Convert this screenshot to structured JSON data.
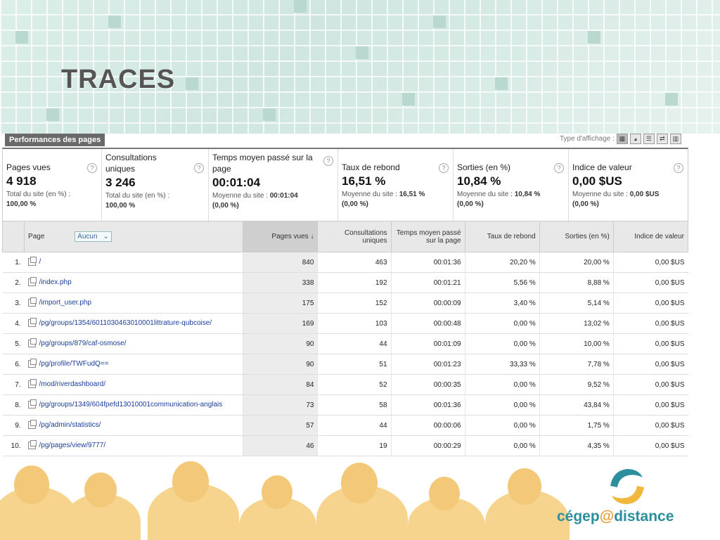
{
  "slide": {
    "title": "TRACES",
    "logo_text_1": "cégep",
    "logo_at": "@",
    "logo_text_2": "distance"
  },
  "panel": {
    "tab_label": "Performances des pages",
    "view_type_label": "Type d'affichage :"
  },
  "metrics": [
    {
      "label": "Pages vues",
      "value": "4 918",
      "sub_label": "Total du site (en %) :",
      "sub_value": "100,00 %"
    },
    {
      "label": "Consultations uniques",
      "value": "3 246",
      "sub_label": "Total du site (en %) :",
      "sub_value": "100,00 %"
    },
    {
      "label": "Temps moyen passé sur la page",
      "value": "00:01:04",
      "sub_label": "Moyenne du site :",
      "sub_value": "00:01:04",
      "sub_extra": "(0,00 %)"
    },
    {
      "label": "Taux de rebond",
      "value": "16,51 %",
      "sub_label": "Moyenne du site :",
      "sub_value": "16,51 %",
      "sub_extra": "(0,00 %)"
    },
    {
      "label": "Sorties (en %)",
      "value": "10,84 %",
      "sub_label": "Moyenne du site :",
      "sub_value": "10,84 %",
      "sub_extra": "(0,00 %)"
    },
    {
      "label": "Indice de valeur",
      "value": "0,00 $US",
      "sub_label": "Moyenne du site :",
      "sub_value": "0,00 $US",
      "sub_extra": "(0,00 %)"
    }
  ],
  "table": {
    "headers": {
      "page": "Page",
      "filter": "Aucun",
      "pageviews": "Pages vues",
      "unique": "Consultations uniques",
      "time": "Temps moyen passé sur la page",
      "bounce": "Taux de rebond",
      "exits": "Sorties (en %)",
      "value": "Indice de valeur"
    },
    "rows": [
      {
        "n": "1.",
        "page": "/",
        "pv": "840",
        "uq": "463",
        "time": "00:01:36",
        "bounce": "20,20 %",
        "exits": "20,00 %",
        "value": "0,00 $US"
      },
      {
        "n": "2.",
        "page": "/index.php",
        "pv": "338",
        "uq": "192",
        "time": "00:01:21",
        "bounce": "5,56 %",
        "exits": "8,88 %",
        "value": "0,00 $US"
      },
      {
        "n": "3.",
        "page": "/import_user.php",
        "pv": "175",
        "uq": "152",
        "time": "00:00:09",
        "bounce": "3,40 %",
        "exits": "5,14 %",
        "value": "0,00 $US"
      },
      {
        "n": "4.",
        "page": "/pg/groups/1354/6011030463010001littrature-qubcoise/",
        "pv": "169",
        "uq": "103",
        "time": "00:00:48",
        "bounce": "0,00 %",
        "exits": "13,02 %",
        "value": "0,00 $US"
      },
      {
        "n": "5.",
        "page": "/pg/groups/879/caf-osmose/",
        "pv": "90",
        "uq": "44",
        "time": "00:01:09",
        "bounce": "0,00 %",
        "exits": "10,00 %",
        "value": "0,00 $US"
      },
      {
        "n": "6.",
        "page": "/pg/profile/TWFudQ==",
        "pv": "90",
        "uq": "51",
        "time": "00:01:23",
        "bounce": "33,33 %",
        "exits": "7,78 %",
        "value": "0,00 $US"
      },
      {
        "n": "7.",
        "page": "/mod/riverdashboard/",
        "pv": "84",
        "uq": "52",
        "time": "00:00:35",
        "bounce": "0,00 %",
        "exits": "9,52 %",
        "value": "0,00 $US"
      },
      {
        "n": "8.",
        "page": "/pg/groups/1349/604fpefd13010001communication-anglais",
        "pv": "73",
        "uq": "58",
        "time": "00:01:36",
        "bounce": "0,00 %",
        "exits": "43,84 %",
        "value": "0,00 $US"
      },
      {
        "n": "9.",
        "page": "/pg/admin/statistics/",
        "pv": "57",
        "uq": "44",
        "time": "00:00:06",
        "bounce": "0,00 %",
        "exits": "1,75 %",
        "value": "0,00 $US"
      },
      {
        "n": "10.",
        "page": "/pg/pages/view/9777/",
        "pv": "46",
        "uq": "19",
        "time": "00:00:29",
        "bounce": "0,00 %",
        "exits": "4,35 %",
        "value": "0,00 $US"
      }
    ]
  }
}
